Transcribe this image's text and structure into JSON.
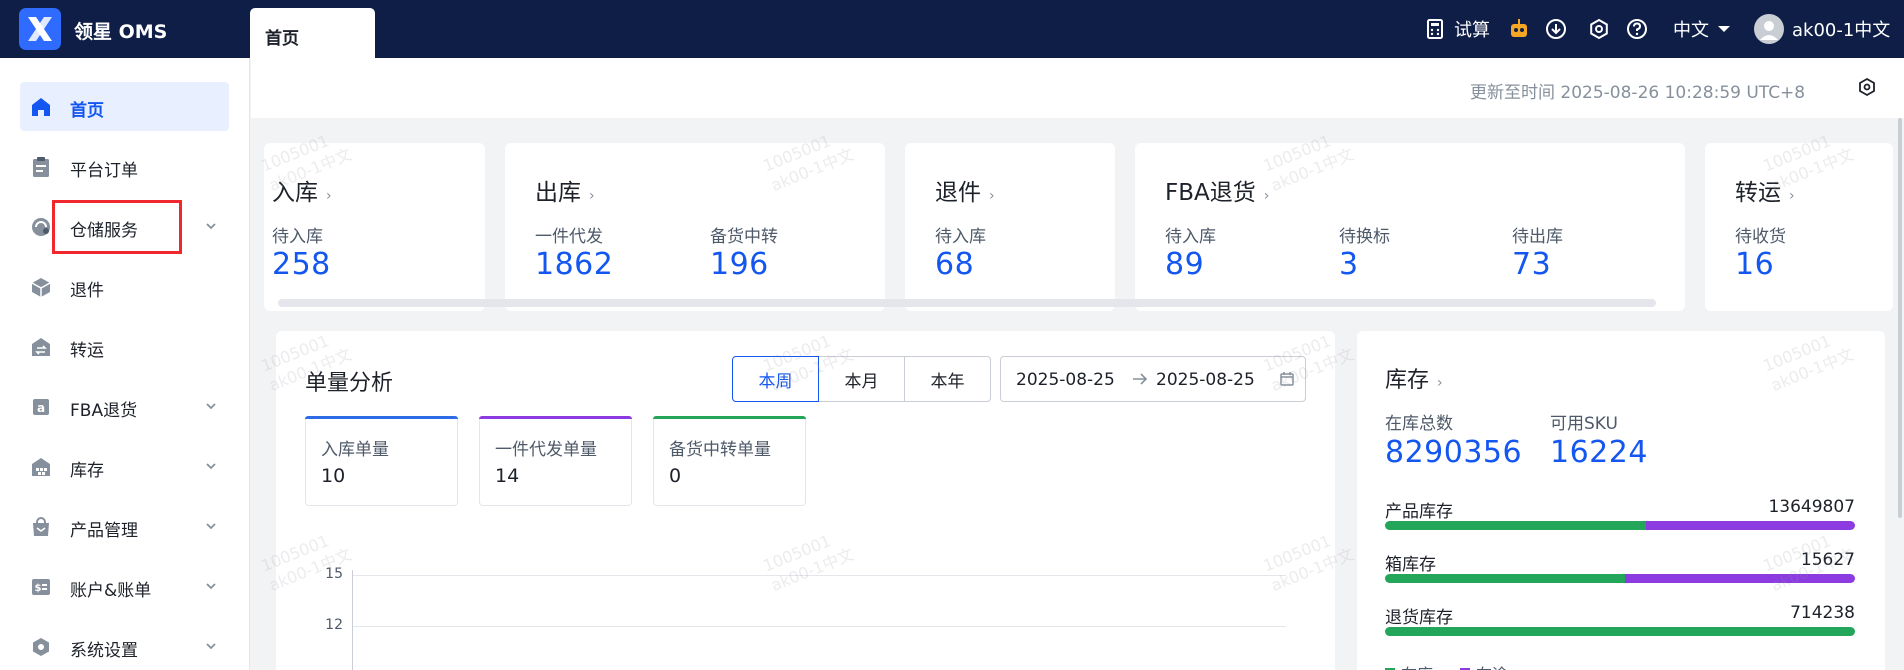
{
  "header": {
    "app_title": "领星 OMS",
    "active_tab": "首页",
    "trial_calc": "试算",
    "language": "中文",
    "username": "ak00-1中文"
  },
  "sidebar": {
    "items": [
      {
        "label": "首页",
        "icon": "home-icon",
        "active": true
      },
      {
        "label": "平台订单",
        "icon": "clipboard-icon"
      },
      {
        "label": "仓储服务",
        "icon": "warehouse-service-icon"
      },
      {
        "label": "退件",
        "icon": "return-box-icon"
      },
      {
        "label": "转运",
        "icon": "transfer-icon"
      },
      {
        "label": "FBA退货",
        "icon": "amazon-icon"
      },
      {
        "label": "库存",
        "icon": "inventory-icon"
      },
      {
        "label": "产品管理",
        "icon": "product-bag-icon"
      },
      {
        "label": "账户&账单",
        "icon": "account-bill-icon"
      },
      {
        "label": "系统设置",
        "icon": "settings-hex-icon"
      }
    ]
  },
  "info_bar": {
    "update_time": "更新至时间 2025-08-26 10:28:59 UTC+8"
  },
  "summary_cards": {
    "inbound": {
      "title": "入库",
      "stats": [
        {
          "label": "待入库",
          "value": "258"
        }
      ]
    },
    "outbound": {
      "title": "出库",
      "stats": [
        {
          "label": "一件代发",
          "value": "1862"
        },
        {
          "label": "备货中转",
          "value": "196"
        }
      ]
    },
    "returns": {
      "title": "退件",
      "stats": [
        {
          "label": "待入库",
          "value": "68"
        }
      ]
    },
    "fba": {
      "title": "FBA退货",
      "stats": [
        {
          "label": "待入库",
          "value": "89"
        },
        {
          "label": "待换标",
          "value": "3"
        },
        {
          "label": "待出库",
          "value": "73"
        }
      ]
    },
    "transfer": {
      "title": "转运",
      "stats": [
        {
          "label": "待收货",
          "value": "16"
        }
      ]
    }
  },
  "volume_analysis": {
    "title": "单量分析",
    "periods": [
      "本周",
      "本月",
      "本年"
    ],
    "active_period": "本周",
    "date_start": "2025-08-25",
    "date_end": "2025-08-25",
    "metrics": [
      {
        "label": "入库单量",
        "value": "10",
        "color": "#2e6be6"
      },
      {
        "label": "一件代发单量",
        "value": "14",
        "color": "#8b3be0"
      },
      {
        "label": "备货中转单量",
        "value": "0",
        "color": "#23a55a"
      }
    ],
    "y_ticks": [
      "15",
      "12"
    ]
  },
  "inventory": {
    "title": "库存",
    "total_label": "在库总数",
    "total_value": "8290356",
    "sku_label": "可用SKU",
    "sku_value": "16224",
    "rows": [
      {
        "label": "产品库存",
        "value": "13649807",
        "green_fraction": 0.555
      },
      {
        "label": "箱库存",
        "value": "15627",
        "green_fraction": 0.51
      },
      {
        "label": "退货库存",
        "value": "714238",
        "green_fraction": 1.0
      }
    ],
    "legend": [
      {
        "label": "在库",
        "color": "#23a55a"
      },
      {
        "label": "在途",
        "color": "#8b3be0"
      }
    ]
  },
  "watermark": {
    "line1": "1005001",
    "line2": "ak00-1中文"
  },
  "colors": {
    "accent": "#1456f0",
    "topbar": "#0f1e47",
    "green": "#23a55a",
    "purple": "#8b3be0"
  }
}
